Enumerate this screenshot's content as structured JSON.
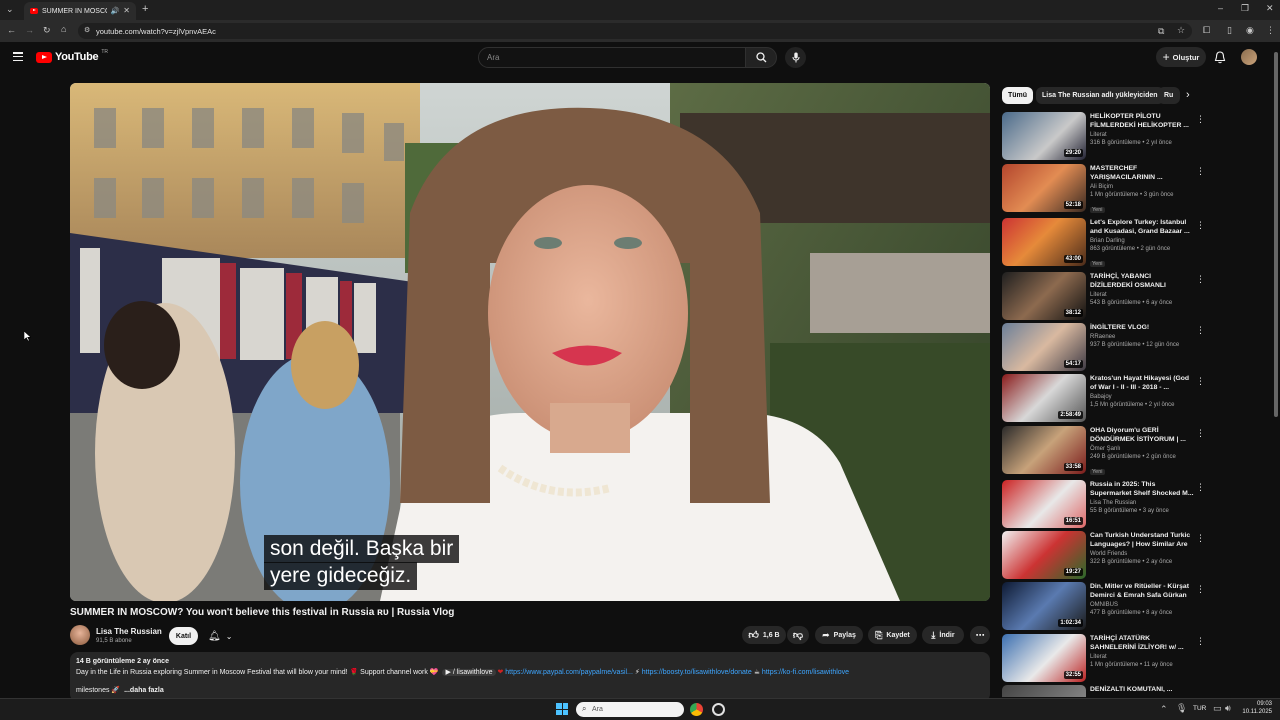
{
  "browser": {
    "tab_title": "SUMMER IN MOSCOW? Yo",
    "url": "youtube.com/watch?v=zjlVpnvAEAc"
  },
  "header": {
    "logo_text": "YouTube",
    "logo_region": "TR",
    "search_placeholder": "Ara",
    "create_label": "Oluştur"
  },
  "video": {
    "subtitle_line1": "son değil.  Başka bir",
    "subtitle_line2": "yere gideceğiz.",
    "title": "SUMMER IN MOSCOW? You won't believe this festival in Russia ʀᴜ | Russia Vlog"
  },
  "channel": {
    "name": "Lisa The Russian",
    "subscribers": "91,5 B abone",
    "join_label": "Katıl"
  },
  "actions": {
    "likes": "1,6 B",
    "share_label": "Paylaş",
    "save_label": "Kaydet",
    "download_label": "İndir"
  },
  "description": {
    "stats": "14 B görüntüleme  2 ay önce",
    "text_part1": "Day in the Life in Russia exploring Summer in Moscow Festival that will blow your mind! 🌹 Support channel work 💝",
    "text_handle": "/ lisawithlove",
    "link_paypal": "https://www.paypal.com/paypalme/vasil...",
    "link_boosty": "https://boosty.to/lisawithlove/donate",
    "link_kofi": "https://ko-fi.com/lisawithlove",
    "line2": "milestones 🚀",
    "more_label": "...daha fazla"
  },
  "sidebar": {
    "chips": [
      "Tümü",
      "Lisa The Russian adlı yükleyiciden",
      "Ru"
    ],
    "recommendations": [
      {
        "title": "HELİKOPTER PİLOTU FİLMLERDEKİ HELİKOPTER ...",
        "channel": "Literat",
        "meta": "316 B görüntüleme • 2 yıl önce",
        "duration": "29:20",
        "badge": ""
      },
      {
        "title": "MASTERCHEF YARIŞMACILARININ ...",
        "channel": "Ali Biçim",
        "meta": "1 Mn görüntüleme • 3 gün önce",
        "duration": "52:18",
        "badge": "Yeni"
      },
      {
        "title": "Let's Explore Turkey: Istanbul and Kusadasi, Grand Bazaar ...",
        "channel": "Brian Darling",
        "meta": "863 görüntüleme • 2 gün önce",
        "duration": "43:00",
        "badge": "Yeni"
      },
      {
        "title": "TARİHÇİ, YABANCI DİZİLERDEKİ OSMANLI SAHNELERİNİ ...",
        "channel": "Literat",
        "meta": "543 B görüntüleme • 6 ay önce",
        "duration": "38:12",
        "badge": ""
      },
      {
        "title": "İNGİLTERE VLOG!",
        "channel": "RRaenee",
        "meta": "937 B görüntüleme • 12 gün önce",
        "duration": "54:17",
        "badge": ""
      },
      {
        "title": "Kratos'un Hayat Hikayesi (God of War I - II - III - 2018 - ...",
        "channel": "Babajoy",
        "meta": "1,5 Mn görüntüleme • 2 yıl önce",
        "duration": "2:58:49",
        "badge": ""
      },
      {
        "title": "OHA Diyorum'u GERİ DÖNDÜRMEK İSTİYORUM | ...",
        "channel": "Ömer Şanlı",
        "meta": "249 B görüntüleme • 2 gün önce",
        "duration": "33:58",
        "badge": "Yeni"
      },
      {
        "title": "Russia in 2025: This Supermarket Shelf Shocked M...",
        "channel": "Lisa The Russian",
        "meta": "55 B görüntüleme • 3 ay önce",
        "duration": "16:51",
        "badge": ""
      },
      {
        "title": "Can Turkish Understand Turkic Languages? | How Similar Are ...",
        "channel": "World Friends",
        "meta": "322 B görüntüleme • 2 ay önce",
        "duration": "19:27",
        "badge": ""
      },
      {
        "title": "Din, Mitler ve Ritüeller - Kürşat Demirci & Emrah Safa Gürkan ...",
        "channel": "OMNIBUS",
        "meta": "477 B görüntüleme • 8 ay önce",
        "duration": "1:02:34",
        "badge": ""
      },
      {
        "title": "TARİHÇİ ATATÜRK SAHNELERİNİ İZLİYOR! w/ ...",
        "channel": "Literat",
        "meta": "1 Mn görüntüleme • 11 ay önce",
        "duration": "32:55",
        "badge": ""
      },
      {
        "title": "DENİZALTI KOMUTANI, ...",
        "channel": "",
        "meta": "",
        "duration": "",
        "badge": ""
      }
    ]
  },
  "taskbar": {
    "search_placeholder": "Ara",
    "lang": "TUR",
    "time": "09:03",
    "date": "10.11.2025"
  },
  "colors": {
    "accent_red": "#ff0000",
    "background": "#0f0f0f",
    "surface": "#272727",
    "link_blue": "#3ea6ff"
  }
}
